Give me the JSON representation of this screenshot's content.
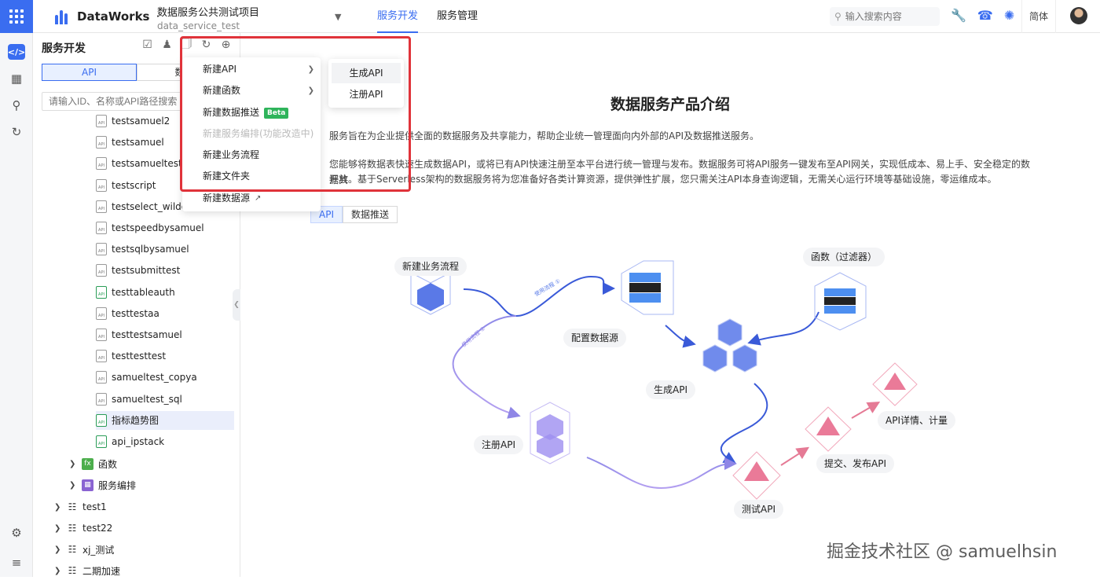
{
  "header": {
    "logo_text": "DataWorks",
    "logo_dot": "·",
    "project_name": "数据服务公共测试项目",
    "project_id": "data_service_test",
    "nav": [
      "服务开发",
      "服务管理"
    ],
    "search_placeholder": "输入搜索内容",
    "lang": "简体",
    "brand_color": "#3a6df0"
  },
  "panel": {
    "title": "服务开发",
    "tabs": [
      "API",
      "数据"
    ],
    "search_placeholder": "请输入ID、名称或API路径搜索",
    "files": [
      {
        "label": "testsamuel2",
        "green": false
      },
      {
        "label": "testsamuel",
        "green": false
      },
      {
        "label": "testsamueltest",
        "green": false
      },
      {
        "label": "testscript",
        "green": false
      },
      {
        "label": "testselect_wildca",
        "green": false
      },
      {
        "label": "testspeedbysamuel",
        "green": false
      },
      {
        "label": "testsqlbysamuel",
        "green": false
      },
      {
        "label": "testsubmittest",
        "green": false
      },
      {
        "label": "testtableauth",
        "green": true
      },
      {
        "label": "testtestaa",
        "green": false
      },
      {
        "label": "testtestsamuel",
        "green": false
      },
      {
        "label": "testtesttest",
        "green": false
      },
      {
        "label": "samueltest_copya",
        "green": false
      },
      {
        "label": "samueltest_sql",
        "green": false
      },
      {
        "label": "指标趋势图",
        "green": true
      },
      {
        "label": "api_ipstack",
        "green": true
      }
    ],
    "file_icon_text": "API",
    "groups": [
      "函数",
      "服务编排"
    ],
    "fx_icon": "fx",
    "projects": [
      "test1",
      "test22",
      "xj_测试",
      "二期加速"
    ]
  },
  "menu": {
    "items": [
      {
        "label": "新建API",
        "arrow": true,
        "disabled": false
      },
      {
        "label": "新建函数",
        "arrow": true,
        "disabled": false
      },
      {
        "label": "新建数据推送",
        "badge": "Beta",
        "disabled": false
      },
      {
        "label": "新建服务编排(功能改造中)",
        "disabled": true
      },
      {
        "label": "新建业务流程",
        "disabled": false
      },
      {
        "label": "新建文件夹",
        "disabled": false
      },
      {
        "label": "新建数据源",
        "external": true,
        "disabled": false
      }
    ],
    "submenu": [
      "生成API",
      "注册API"
    ]
  },
  "content": {
    "title": "数据服务产品介绍",
    "para1": "服务旨在为企业提供全面的数据服务及共享能力，帮助企业统一管理面向内外部的API及数据推送服务。",
    "para2a": "您能够将数据表快速生成数据API，或将已有API快速注册至本平台进行统一管理与发布。数据服务可将API服务一键发布至API网关，实现低成本、易上手、安全稳定的数据共",
    "para2b": "开放。基于Serverless架构的数据服务将为您准备好各类计算资源，提供弹性扩展，您只需关注API本身查询逻辑，无需关心运行环境等基础设施，零运维成本。",
    "tabs": [
      "API",
      "数据推送"
    ],
    "diagram_labels": {
      "workflow": "新建业务流程",
      "function": "函数（过滤器）",
      "datasource": "配置数据源",
      "generate": "生成API",
      "register": "注册API",
      "test": "测试API",
      "publish": "提交、发布API",
      "detail": "API详情、计量",
      "flow_a": "使用流程 ①",
      "flow_b": "使用流程 ②"
    }
  },
  "watermark": "掘金技术社区 @ samuelhsin"
}
